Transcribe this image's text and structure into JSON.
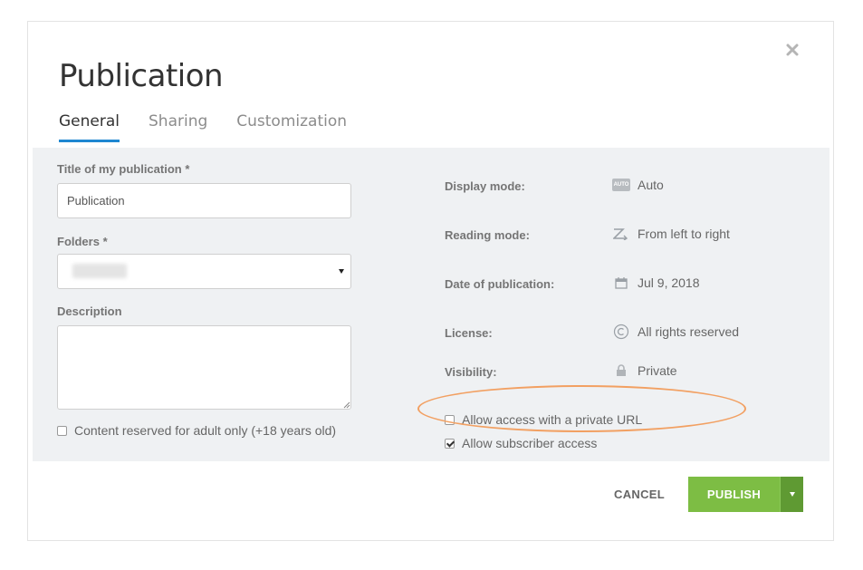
{
  "dialog": {
    "title": "Publication",
    "tabs": [
      {
        "label": "General",
        "active": true
      },
      {
        "label": "Sharing",
        "active": false
      },
      {
        "label": "Customization",
        "active": false
      }
    ]
  },
  "form": {
    "title_label": "Title of my publication *",
    "title_value": "Publication",
    "folders_label": "Folders *",
    "description_label": "Description",
    "description_value": "",
    "adult_label": "Content reserved for adult only (+18 years old)",
    "adult_checked": false
  },
  "settings": {
    "display_mode_label": "Display mode:",
    "display_mode_icon_text": "AUTO",
    "display_mode_value": "Auto",
    "reading_mode_label": "Reading mode:",
    "reading_mode_value": "From left to right",
    "date_label": "Date of publication:",
    "date_value": "Jul 9, 2018",
    "license_label": "License:",
    "license_value": "All rights reserved",
    "visibility_label": "Visibility:",
    "visibility_value": "Private",
    "private_url_label": "Allow access with a private URL",
    "private_url_checked": false,
    "subscriber_label": "Allow subscriber access",
    "subscriber_checked": true
  },
  "footer": {
    "cancel_label": "CANCEL",
    "publish_label": "PUBLISH"
  },
  "colors": {
    "accent": "#1f87d1",
    "publish": "#7dbd44",
    "publish_dropdown": "#5f9a33",
    "highlight": "#f2a062",
    "panel": "#eff1f3"
  },
  "icons": {
    "close": "close-icon",
    "display_mode": "auto-icon",
    "reading_mode": "left-to-right-icon",
    "date": "calendar-icon",
    "license": "copyright-icon",
    "visibility": "lock-icon",
    "select": "chevron-down-icon",
    "publish_dropdown": "caret-down-icon"
  }
}
